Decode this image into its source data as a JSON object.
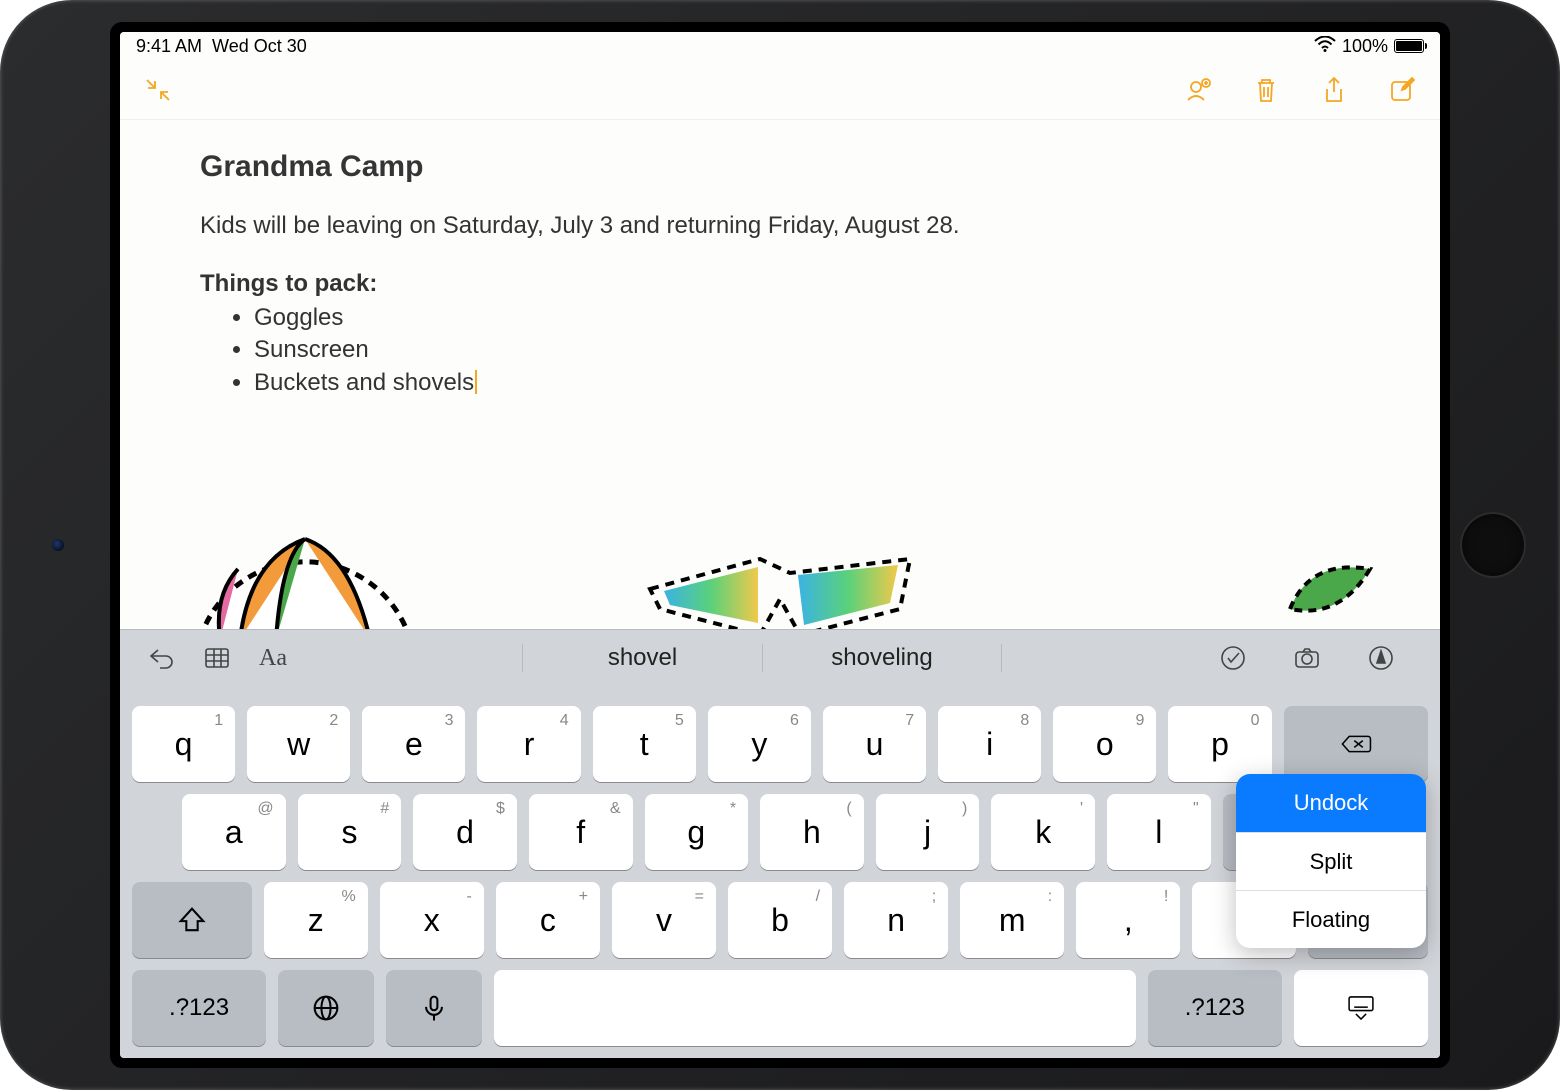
{
  "status": {
    "time": "9:41 AM",
    "date": "Wed Oct 30",
    "battery_pct": "100%"
  },
  "note": {
    "title": "Grandma Camp",
    "body": "Kids will be leaving on Saturday, July 3 and returning Friday, August 28.",
    "list_header": "Things to pack:",
    "items": [
      "Goggles",
      "Sunscreen",
      "Buckets and shovels"
    ]
  },
  "suggestions": [
    "shovel",
    "shoveling"
  ],
  "keys": {
    "row1": [
      {
        "main": "q",
        "alt": "1"
      },
      {
        "main": "w",
        "alt": "2"
      },
      {
        "main": "e",
        "alt": "3"
      },
      {
        "main": "r",
        "alt": "4"
      },
      {
        "main": "t",
        "alt": "5"
      },
      {
        "main": "y",
        "alt": "6"
      },
      {
        "main": "u",
        "alt": "7"
      },
      {
        "main": "i",
        "alt": "8"
      },
      {
        "main": "o",
        "alt": "9"
      },
      {
        "main": "p",
        "alt": "0"
      }
    ],
    "row2": [
      {
        "main": "a",
        "alt": "@"
      },
      {
        "main": "s",
        "alt": "#"
      },
      {
        "main": "d",
        "alt": "$"
      },
      {
        "main": "f",
        "alt": "&"
      },
      {
        "main": "g",
        "alt": "*"
      },
      {
        "main": "h",
        "alt": "("
      },
      {
        "main": "j",
        "alt": ")"
      },
      {
        "main": "k",
        "alt": "'"
      },
      {
        "main": "l",
        "alt": "\""
      }
    ],
    "row3": [
      {
        "main": "z",
        "alt": "%"
      },
      {
        "main": "x",
        "alt": "-"
      },
      {
        "main": "c",
        "alt": "+"
      },
      {
        "main": "v",
        "alt": "="
      },
      {
        "main": "b",
        "alt": "/"
      },
      {
        "main": "n",
        "alt": ";"
      },
      {
        "main": "m",
        "alt": ":"
      },
      {
        "main": ",",
        "alt": "!"
      },
      {
        "main": ".",
        "alt": "?"
      }
    ],
    "numkey": ".?123"
  },
  "kb_menu": {
    "items": [
      "Undock",
      "Split",
      "Floating"
    ],
    "selected": 0
  }
}
